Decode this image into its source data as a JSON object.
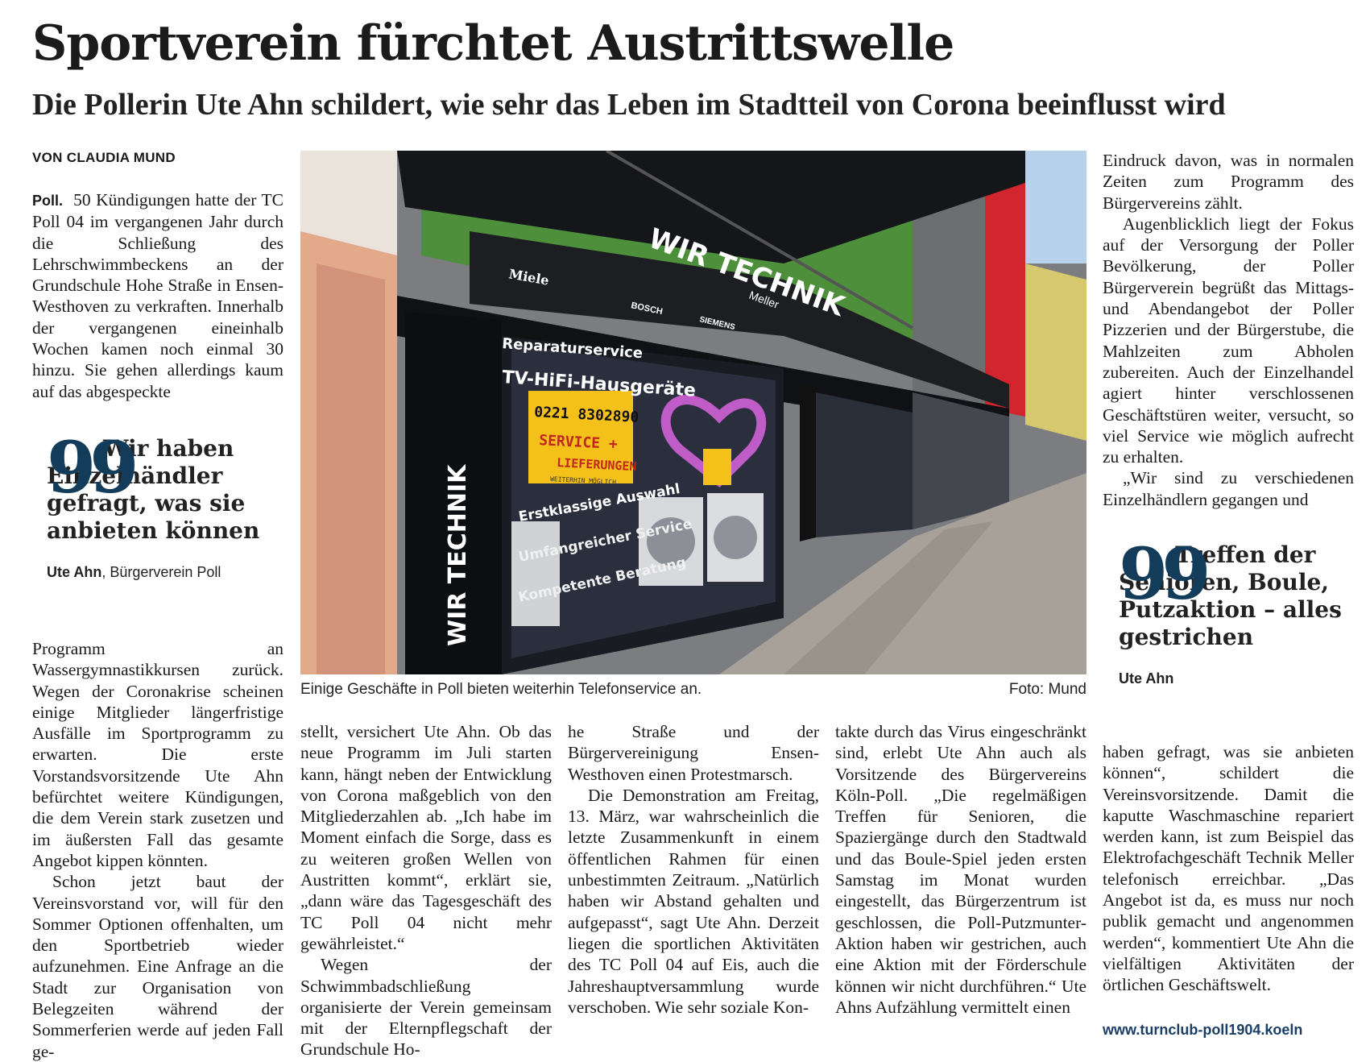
{
  "headline": "Sportverein fürchtet Austrittswelle",
  "subline": "Die Pollerin Ute Ahn schildert, wie sehr das Leben im Stadtteil von Corona beeinflusst wird",
  "byline": "VON CLAUDIA MUND",
  "dateline": "Poll.",
  "col1_top": "50 Kündigungen hatte der TC Poll 04 im vergangenen Jahr durch die Schließung des Lehrschwimmbeckens an der Grundschule Hohe Straße in Ensen-Westhoven zu verkraften. Innerhalb der vergangenen eineinhalb Wochen kamen noch einmal 30 hinzu. Sie gehen allerdings kaum auf das abgespeckte",
  "quote1": {
    "mark": "99",
    "text": "Wir haben Einzelhändler gefragt, was sie anbieten können",
    "author": "Ute Ahn",
    "role": ", Bürgerverein Poll"
  },
  "col1_bottom": [
    "Programm an Wassergymnastikkursen zurück. Wegen der Coronakrise scheinen einige Mitglieder längerfristige Ausfälle im Sportprogramm zu erwarten. Die erste Vorstandsvorsitzende Ute Ahn befürchtet weitere Kündigungen, die dem Verein stark zusetzen und im äußersten Fall das gesamte Angebot kippen könnten.",
    "Schon jetzt baut der Vereinsvorstand vor, will für den Sommer Optionen offenhalten, um den Sportbetrieb wieder aufzunehmen. Eine Anfrage an die Stadt zur Organisation von Belegzeiten während der Sommerferien werde auf jeden Fall ge-"
  ],
  "photo": {
    "signs": {
      "brand": "WIR TECHNIK",
      "brand_sub": "Meller",
      "miele": "Miele",
      "bosch": "BOSCH",
      "siemens": "SIEMENS",
      "service1": "Reparaturservice",
      "service2": "TV-HiFi-Hausgeräte",
      "phone": "0221 8302890",
      "note1": "SERVICE +",
      "note2": "LIEFERUNGEN",
      "note3": "WEITERHIN MÖGLICH",
      "ad1": "Erstklassige Auswahl",
      "ad2": "Umfangreicher Service",
      "ad3": "Kompetente Beratung"
    }
  },
  "caption": "Einige Geschäfte in Poll bieten weiterhin Telefonservice an.",
  "credit": "Foto: Mund",
  "col2": [
    "stellt, versichert Ute Ahn. Ob das neue Programm im Juli starten kann, hängt neben der Entwicklung von Corona maßgeblich von den Mitgliederzahlen ab. „Ich habe im Moment einfach die Sorge, dass es zu weiteren großen Wellen von Austritten kommt“, erklärt sie, „dann wäre das Tagesgeschäft des TC Poll 04 nicht mehr gewährleistet.“",
    "Wegen der Schwimmbadschließung organisierte der Verein gemeinsam mit der Elternpflegschaft der Grundschule Ho-"
  ],
  "col3": [
    "he Straße und der Bürgervereinigung Ensen-Westhoven einen Protestmarsch.",
    "Die Demonstration am Freitag, 13. März, war wahrscheinlich die letzte Zusammenkunft in einem öffentlichen Rahmen für einen unbestimmten Zeitraum. „Natürlich haben wir Abstand gehalten und aufgepasst“, sagt Ute Ahn. Derzeit liegen die sportlichen Aktivitäten des TC Poll 04 auf Eis, auch die Jahreshauptversammlung wurde verschoben. Wie sehr soziale Kon-"
  ],
  "col4": [
    "takte durch das Virus eingeschränkt sind, erlebt Ute Ahn auch als Vorsitzende des Bürgervereins Köln-Poll. „Die regelmäßigen Treffen für Senioren, die Spaziergänge durch den Stadtwald und das Boule-Spiel jeden ersten Samstag im Monat wurden eingestellt, das Bürgerzentrum ist geschlossen, die Poll-Putzmunter-Aktion haben wir gestrichen, auch eine Aktion mit der Förderschule können wir nicht durchführen.“ Ute Ahns Aufzählung vermittelt einen"
  ],
  "col5_top": [
    "Eindruck davon, was in normalen Zeiten zum Programm des Bürgervereins zählt.",
    "Augenblicklich liegt der Fokus auf der Versorgung der Poller Bevölkerung, der Poller Bürgerverein begrüßt das Mittags- und Abendangebot der Poller Pizzerien und der Bürgerstube, die Mahlzeiten zum Abholen zubereiten. Auch der Einzelhandel agiert hinter verschlossenen Geschäftstüren weiter, versucht, so viel Service wie möglich aufrecht zu erhalten.",
    "„Wir sind zu verschiedenen Einzelhändlern gegangen und"
  ],
  "quote2": {
    "mark": "99",
    "text": "Treffen der Senioren, Boule, Putzaktion – alles gestrichen",
    "author": "Ute Ahn"
  },
  "col5_bottom": [
    "haben gefragt, was sie anbieten können“, schildert die Vereinsvorsitzende. Damit die kaputte Waschmaschine repariert werden kann, ist zum Beispiel das Elektrofachgeschäft Technik Meller telefonisch erreichbar. „Das Angebot ist da, es muss nur noch publik gemacht und angenommen werden“, kommentiert Ute Ahn die vielfältigen Aktivitäten der örtlichen Geschäftswelt."
  ],
  "weblink": "www.turnclub-poll1904.koeln"
}
